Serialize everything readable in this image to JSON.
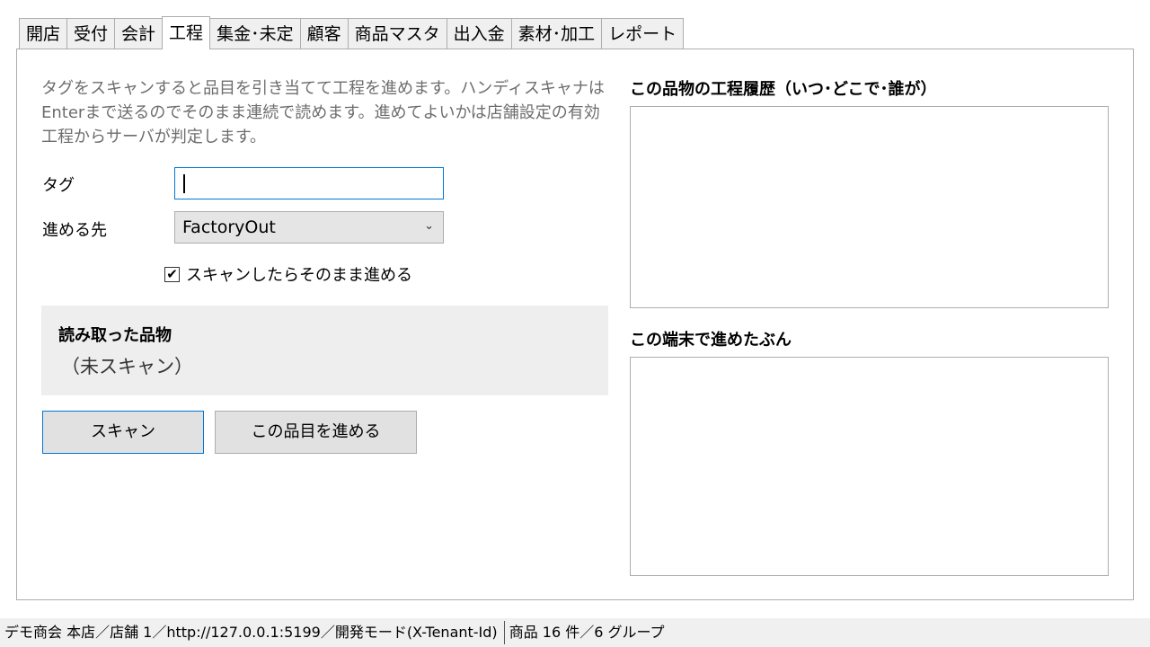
{
  "tabs": [
    {
      "label": "開店"
    },
    {
      "label": "受付"
    },
    {
      "label": "会計"
    },
    {
      "label": "工程",
      "active": true
    },
    {
      "label": "集金･未定"
    },
    {
      "label": "顧客"
    },
    {
      "label": "商品マスタ"
    },
    {
      "label": "出入金"
    },
    {
      "label": "素材･加工"
    },
    {
      "label": "レポート"
    }
  ],
  "form": {
    "description": "タグをスキャンすると品目を引き当てて工程を進めます。ハンディスキャナは Enterまで送るのでそのまま連続で読めます。進めてよいかは店舗設定の有効工程からサーバが判定します。",
    "tag_label": "タグ",
    "tag_value": "",
    "dest_label": "進める先",
    "dest_value": "FactoryOut",
    "auto_checkbox_label": "スキャンしたらそのまま進める",
    "auto_checked": true,
    "read_title": "読み取った品物",
    "read_value": "（未スキャン）",
    "scan_button": "スキャン",
    "advance_button": "この品目を進める"
  },
  "right": {
    "history_title": "この品物の工程履歴（いつ･どこで･誰が）",
    "terminal_title": "この端末で進めたぶん"
  },
  "status_bar": {
    "connection": "デモ商会 本店／店舗 1／http://127.0.0.1:5199／開発モード(X-Tenant-Id)",
    "products": "商品 16 件／6 グループ"
  },
  "icons": {
    "dropdown": "chevron-down-icon",
    "checkbox": "checkmark-icon"
  }
}
